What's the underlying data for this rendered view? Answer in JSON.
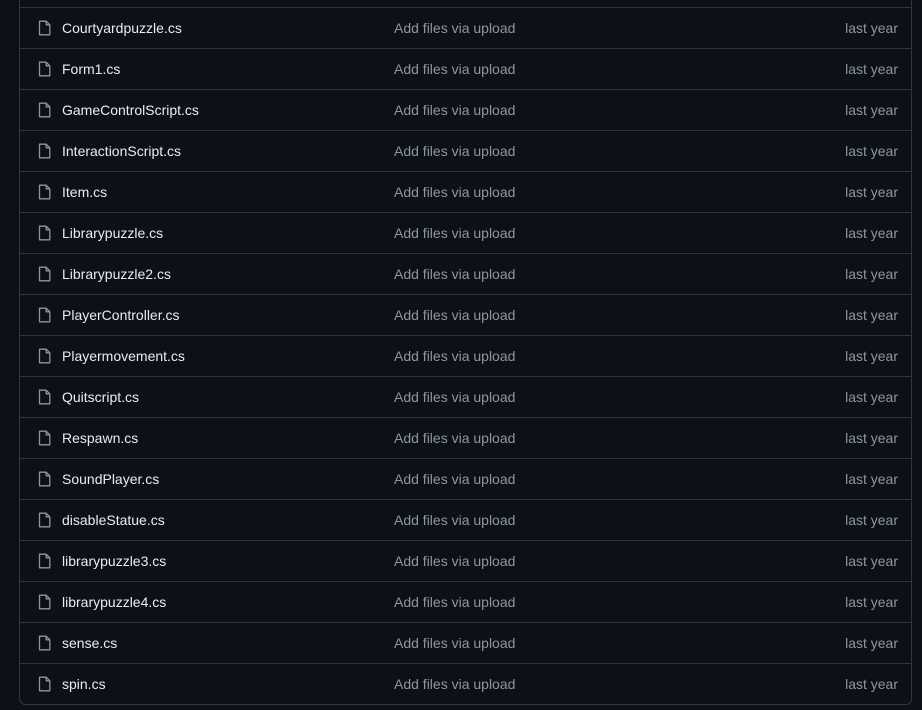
{
  "colors": {
    "background": "#0d1117",
    "border": "#30363d",
    "text_primary": "#e6edf3",
    "text_muted": "#8d96a0"
  },
  "rows": [
    {
      "icon": "file-icon",
      "name": "Courtyardpuzzle.cs",
      "commit": "Add files via upload",
      "age": "last year"
    },
    {
      "icon": "file-icon",
      "name": "Form1.cs",
      "commit": "Add files via upload",
      "age": "last year"
    },
    {
      "icon": "file-icon",
      "name": "GameControlScript.cs",
      "commit": "Add files via upload",
      "age": "last year"
    },
    {
      "icon": "file-icon",
      "name": "InteractionScript.cs",
      "commit": "Add files via upload",
      "age": "last year"
    },
    {
      "icon": "file-icon",
      "name": "Item.cs",
      "commit": "Add files via upload",
      "age": "last year"
    },
    {
      "icon": "file-icon",
      "name": "Librarypuzzle.cs",
      "commit": "Add files via upload",
      "age": "last year"
    },
    {
      "icon": "file-icon",
      "name": "Librarypuzzle2.cs",
      "commit": "Add files via upload",
      "age": "last year"
    },
    {
      "icon": "file-icon",
      "name": "PlayerController.cs",
      "commit": "Add files via upload",
      "age": "last year"
    },
    {
      "icon": "file-icon",
      "name": "Playermovement.cs",
      "commit": "Add files via upload",
      "age": "last year"
    },
    {
      "icon": "file-icon",
      "name": "Quitscript.cs",
      "commit": "Add files via upload",
      "age": "last year"
    },
    {
      "icon": "file-icon",
      "name": "Respawn.cs",
      "commit": "Add files via upload",
      "age": "last year"
    },
    {
      "icon": "file-icon",
      "name": "SoundPlayer.cs",
      "commit": "Add files via upload",
      "age": "last year"
    },
    {
      "icon": "file-icon",
      "name": "disableStatue.cs",
      "commit": "Add files via upload",
      "age": "last year"
    },
    {
      "icon": "file-icon",
      "name": "librarypuzzle3.cs",
      "commit": "Add files via upload",
      "age": "last year"
    },
    {
      "icon": "file-icon",
      "name": "librarypuzzle4.cs",
      "commit": "Add files via upload",
      "age": "last year"
    },
    {
      "icon": "file-icon",
      "name": "sense.cs",
      "commit": "Add files via upload",
      "age": "last year"
    },
    {
      "icon": "file-icon",
      "name": "spin.cs",
      "commit": "Add files via upload",
      "age": "last year"
    }
  ]
}
